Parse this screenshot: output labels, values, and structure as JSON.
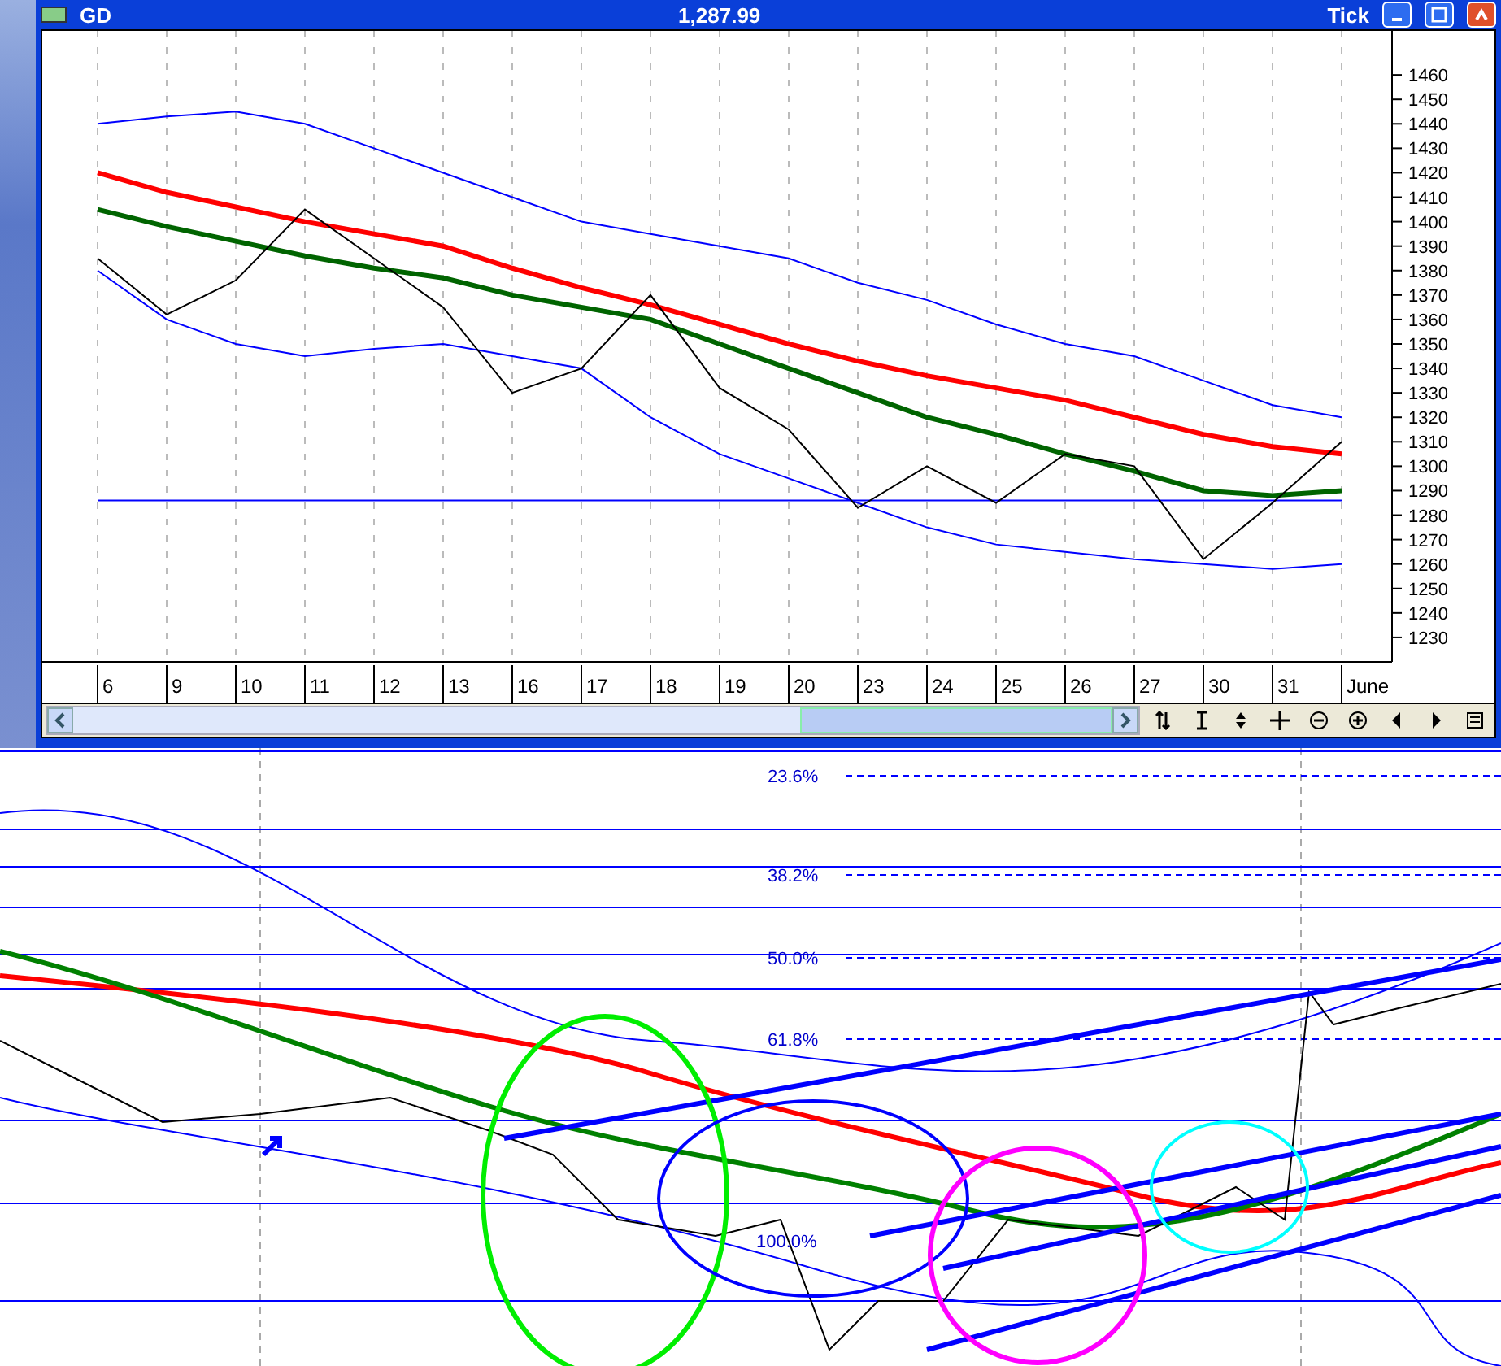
{
  "window": {
    "title": "GD",
    "price": "1,287.99",
    "interval": "Tick"
  },
  "chart": {
    "chart_data": {
      "type": "line",
      "categories": [
        "6",
        "9",
        "10",
        "11",
        "12",
        "13",
        "16",
        "17",
        "18",
        "19",
        "20",
        "23",
        "24",
        "25",
        "26",
        "27",
        "30",
        "31",
        "June"
      ],
      "ylim": [
        1220,
        1478
      ],
      "yticks": [
        1230,
        1240,
        1250,
        1260,
        1270,
        1280,
        1290,
        1300,
        1310,
        1320,
        1330,
        1340,
        1350,
        1360,
        1370,
        1380,
        1390,
        1400,
        1410,
        1420,
        1430,
        1440,
        1450,
        1460
      ],
      "series": [
        {
          "color": "#0000ff",
          "values": [
            1440,
            1443,
            1445,
            1440,
            1430,
            1420,
            1410,
            1400,
            1395,
            1390,
            1385,
            1375,
            1368,
            1358,
            1350,
            1345,
            1335,
            1325,
            1320
          ]
        },
        {
          "color": "#0000ff",
          "values": [
            1380,
            1360,
            1350,
            1345,
            1348,
            1350,
            1345,
            1340,
            1320,
            1305,
            1295,
            1285,
            1275,
            1268,
            1265,
            1262,
            1260,
            1258,
            1260
          ]
        },
        {
          "color": "#ff0000",
          "values": [
            1420,
            1412,
            1406,
            1400,
            1395,
            1390,
            1381,
            1373,
            1366,
            1358,
            1350,
            1343,
            1337,
            1332,
            1327,
            1320,
            1313,
            1308,
            1305
          ]
        },
        {
          "color": "#006400",
          "values": [
            1405,
            1398,
            1392,
            1386,
            1381,
            1377,
            1370,
            1365,
            1360,
            1350,
            1340,
            1330,
            1320,
            1313,
            1305,
            1298,
            1290,
            1288,
            1290
          ]
        },
        {
          "color": "#0000ff",
          "values": [
            1286,
            1286,
            1286,
            1286,
            1286,
            1286,
            1286,
            1286,
            1286,
            1286,
            1286,
            1286,
            1286,
            1286,
            1286,
            1286,
            1286,
            1286,
            1286
          ]
        },
        {
          "color": "#000000",
          "values": [
            1385,
            1362,
            1376,
            1405,
            1385,
            1365,
            1330,
            1340,
            1370,
            1332,
            1315,
            1283,
            1300,
            1285,
            1305,
            1300,
            1262,
            1285,
            1310
          ]
        }
      ]
    }
  },
  "lower_chart": {
    "fib_levels": [
      "23.6%",
      "38.2%",
      "50.0%",
      "61.8%",
      "100.0%"
    ]
  }
}
